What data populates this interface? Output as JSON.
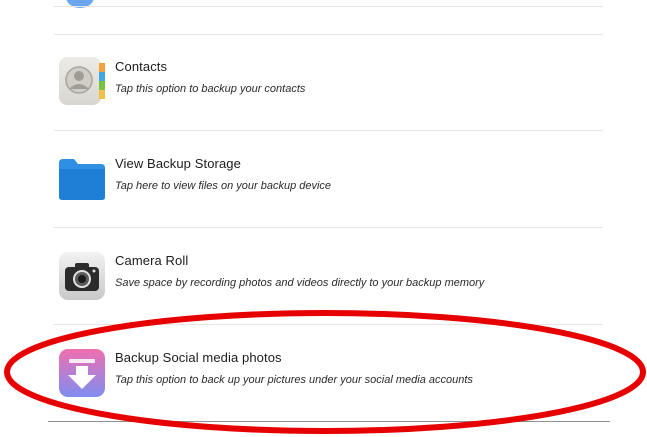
{
  "list": {
    "items": [
      {
        "title": "Contacts",
        "subtitle": "Tap this option to backup your contacts",
        "icon": "contacts-icon"
      },
      {
        "title": "View Backup Storage",
        "subtitle": "Tap here to view files on your backup device",
        "icon": "folder-icon"
      },
      {
        "title": "Camera Roll",
        "subtitle": "Save space by recording photos and videos directly to your backup memory",
        "icon": "camera-icon"
      },
      {
        "title": "Backup Social media photos",
        "subtitle": "Tap this option to back up your pictures under your social media accounts",
        "icon": "download-icon"
      }
    ]
  },
  "colors": {
    "annotation_ellipse": "#e60000",
    "folder_blue": "#2f8fe2",
    "download_gradient_start": "#f06fb0",
    "download_gradient_end": "#7f8df0"
  }
}
